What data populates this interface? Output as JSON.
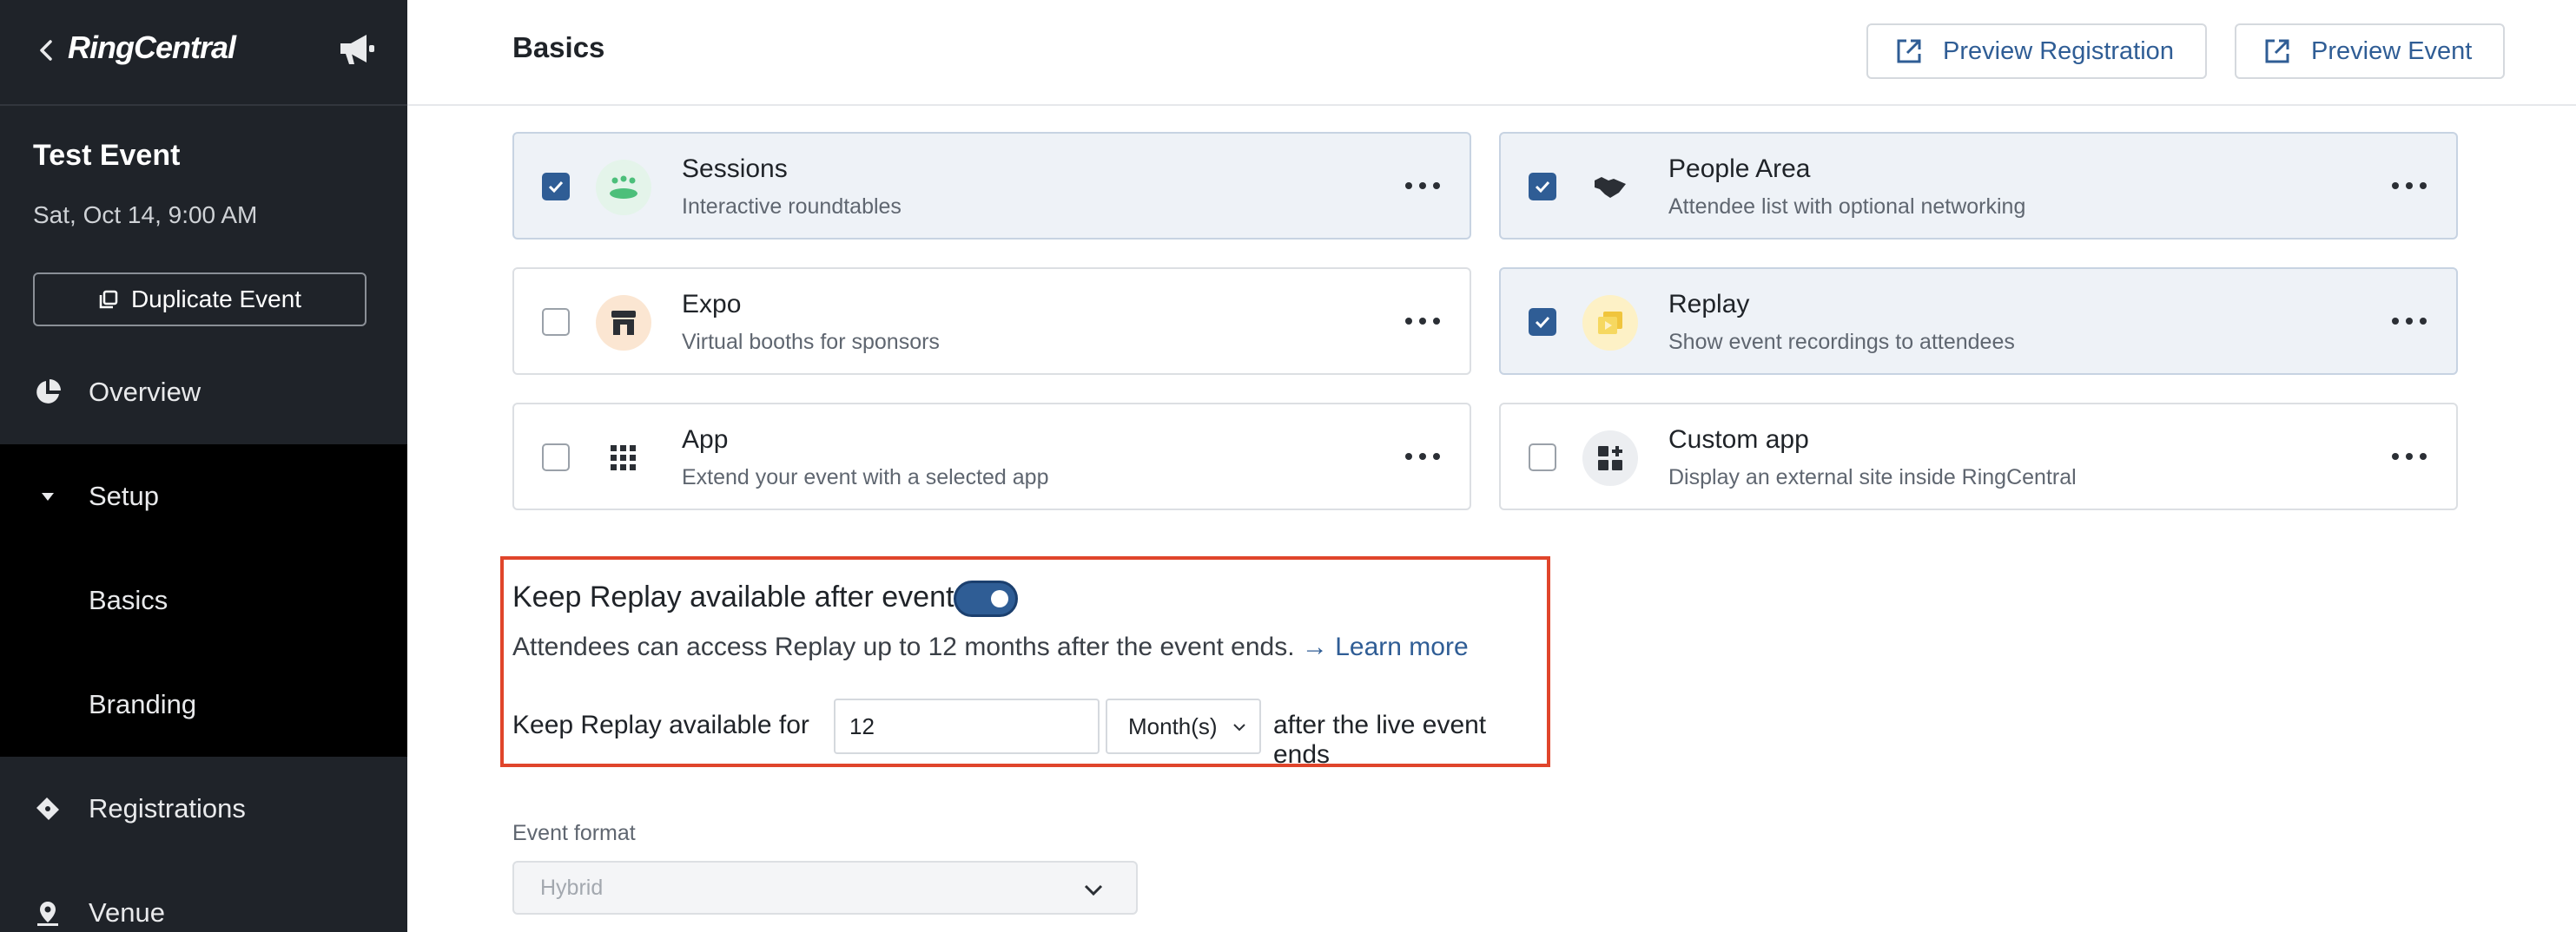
{
  "sidebar": {
    "logo": "RingCentral",
    "event_title": "Test Event",
    "event_date": "Sat, Oct 14, 9:00 AM",
    "duplicate_label": "Duplicate Event",
    "nav": {
      "overview": "Overview",
      "setup": "Setup",
      "basics": "Basics",
      "branding": "Branding",
      "registrations": "Registrations",
      "venue": "Venue"
    }
  },
  "header": {
    "title": "Basics",
    "preview_registration": "Preview Registration",
    "preview_event": "Preview Event"
  },
  "features": [
    {
      "title": "Sessions",
      "subtitle": "Interactive roundtables",
      "checked": true
    },
    {
      "title": "People Area",
      "subtitle": "Attendee list with optional networking",
      "checked": true
    },
    {
      "title": "Expo",
      "subtitle": "Virtual booths for sponsors",
      "checked": false
    },
    {
      "title": "Replay",
      "subtitle": "Show event recordings to attendees",
      "checked": true
    },
    {
      "title": "App",
      "subtitle": "Extend your event with a selected app",
      "checked": false
    },
    {
      "title": "Custom app",
      "subtitle": "Display an external site inside RingCentral",
      "checked": false
    }
  ],
  "replay": {
    "title": "Keep Replay available after event",
    "toggle_on": true,
    "description": "Attendees can access Replay up to 12 months after the event ends.",
    "learn_more": "→ Learn more",
    "keep_label": "Keep Replay available for",
    "duration_value": "12",
    "duration_unit": "Month(s)",
    "after_label": "after the live event ends"
  },
  "event_format": {
    "label": "Event format",
    "value": "Hybrid"
  },
  "colors": {
    "sidebar_bg": "#1f2329",
    "accent": "#2f5d95",
    "highlight_border": "#e0452b"
  }
}
